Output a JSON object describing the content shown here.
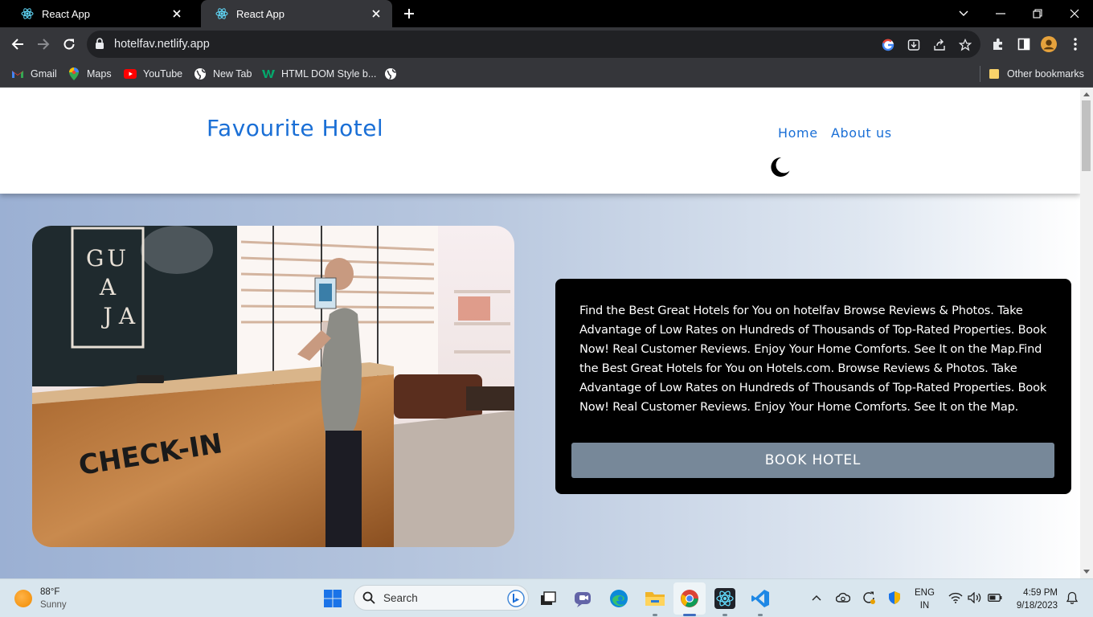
{
  "browser": {
    "tabs": [
      {
        "title": "React App"
      },
      {
        "title": "React App"
      }
    ],
    "url": "hotelfav.netlify.app",
    "bookmarks": [
      {
        "label": "Gmail"
      },
      {
        "label": "Maps"
      },
      {
        "label": "YouTube"
      },
      {
        "label": "New Tab"
      },
      {
        "label": "HTML DOM Style b..."
      }
    ],
    "other_bookmarks": "Other bookmarks"
  },
  "site": {
    "brand": "Favourite Hotel",
    "nav": {
      "home": "Home",
      "about": "About us"
    },
    "theme_toggle_icon": "moon-icon",
    "colors": {
      "brand": "#1a6fd6",
      "button": "#778899",
      "card": "#000000"
    },
    "hero": {
      "image_sign": [
        "GU",
        "A",
        "J",
        "A"
      ],
      "image_counter_text": "CHECK-IN",
      "description": "Find the Best Great Hotels for You on hotelfav Browse Reviews & Photos. Take Advantage of Low Rates on Hundreds of Thousands of Top-Rated Properties. Book Now! Real Customer Reviews. Enjoy Your Home Comforts. See It on the Map.Find the Best Great Hotels for You on Hotels.com. Browse Reviews & Photos. Take Advantage of Low Rates on Hundreds of Thousands of Top-Rated Properties. Book Now! Real Customer Reviews. Enjoy Your Home Comforts. See It on the Map.",
      "button": "BOOK HOTEL"
    }
  },
  "taskbar": {
    "weather": {
      "temp": "88°F",
      "condition": "Sunny"
    },
    "search_placeholder": "Search",
    "language": {
      "line1": "ENG",
      "line2": "IN"
    },
    "clock": {
      "time": "4:59 PM",
      "date": "9/18/2023"
    }
  }
}
